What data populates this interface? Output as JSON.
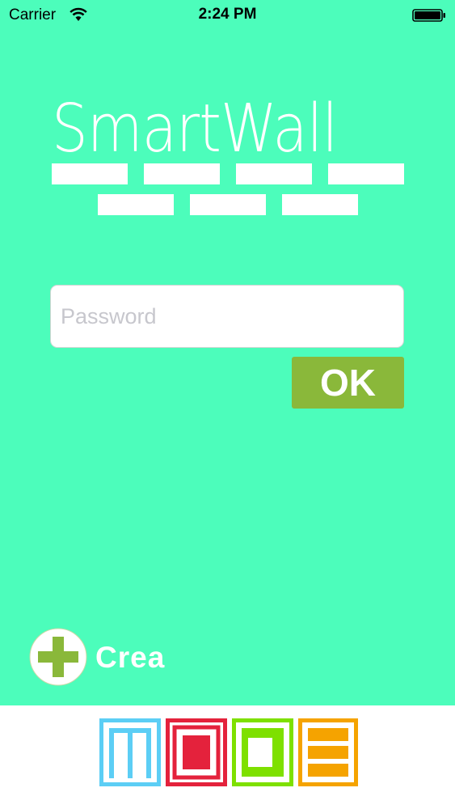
{
  "status_bar": {
    "carrier": "Carrier",
    "time": "2:24 PM"
  },
  "app": {
    "title": "SmartWall"
  },
  "login": {
    "password_placeholder": "Password",
    "password_value": "",
    "ok_label": "OK"
  },
  "create": {
    "label": "Crea"
  },
  "colors": {
    "background": "#4cfdbb",
    "ok_button": "#8ab83a",
    "plus_icon": "#8ab83a",
    "logo_blue": "#5ccef5",
    "logo_red": "#e4223c",
    "logo_green": "#7ee000",
    "logo_orange": "#f5a300"
  },
  "icons": {
    "wifi": "wifi-icon",
    "battery": "battery-icon",
    "plus": "plus-icon",
    "logo": "mode-logo"
  }
}
